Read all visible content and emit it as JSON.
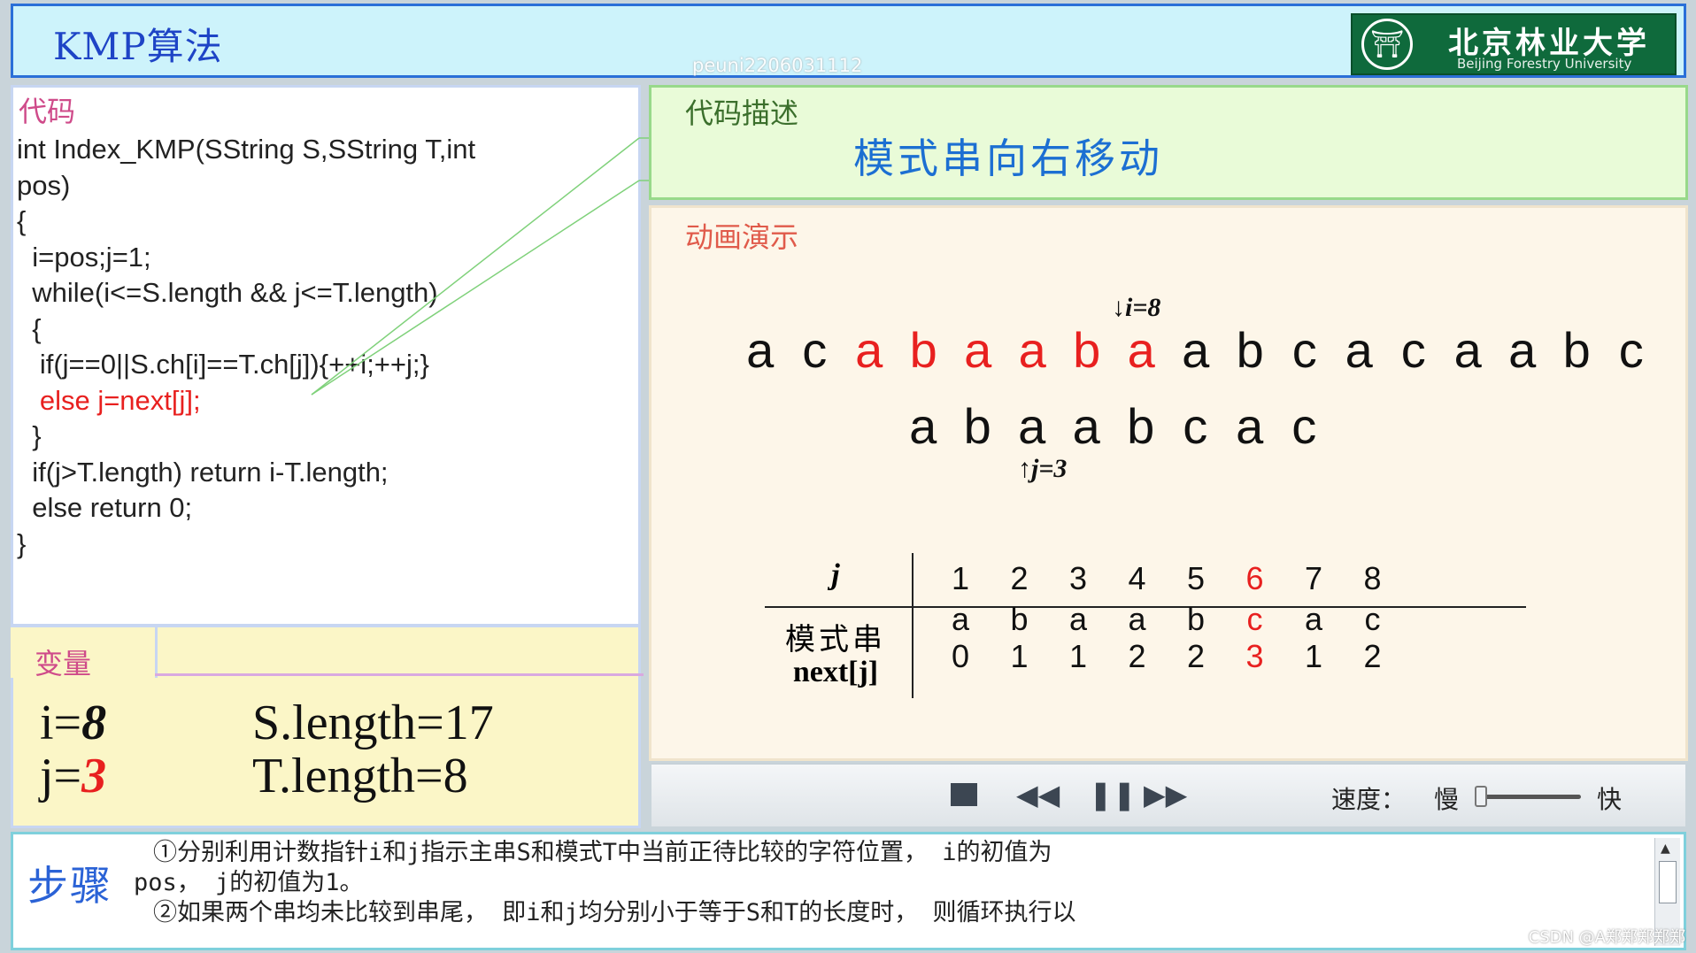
{
  "header": {
    "title": "KMP算法",
    "logo_cn": "北京林业大学",
    "logo_en": "Beijing Forestry University",
    "watermark": "peuni2206031112"
  },
  "code_panel": {
    "label": "代码",
    "lines": [
      "int Index_KMP(SString S,SString T,int",
      "pos)",
      "{",
      "  i=pos;j=1;",
      "  while(i<=S.length && j<=T.length)",
      "  {",
      "   if(j==0||S.ch[i]==T.ch[j]){++i;++j;}",
      "   else j=next[j];",
      "  }",
      "  if(j>T.length) return i-T.length;",
      "  else return 0;",
      "}"
    ],
    "highlight_line": 7,
    "highlight_color": "#e8201f"
  },
  "variables": {
    "label": "变量",
    "i_label": "i=",
    "i_value": "8",
    "j_label": "j=",
    "j_value": "3",
    "s_length": "S.length=17",
    "t_length": "T.length=8"
  },
  "description": {
    "label": "代码描述",
    "text": "模式串向右移动"
  },
  "animation": {
    "label": "动画演示",
    "main_string": [
      "a",
      "c",
      "a",
      "b",
      "a",
      "a",
      "b",
      "a",
      "a",
      "b",
      "c",
      "a",
      "c",
      "a",
      "a",
      "b",
      "c"
    ],
    "main_highlight": [
      2,
      3,
      4,
      5,
      6,
      7
    ],
    "pattern_string": [
      "a",
      "b",
      "a",
      "a",
      "b",
      "c",
      "a",
      "c"
    ],
    "pointer_i": "i=8",
    "pointer_j": "j=3",
    "next_table": {
      "header_j": "j",
      "header_pattern": "模式串",
      "header_next": "next[j]",
      "j": [
        "1",
        "2",
        "3",
        "4",
        "5",
        "6",
        "7",
        "8"
      ],
      "pattern": [
        "a",
        "b",
        "a",
        "a",
        "b",
        "c",
        "a",
        "c"
      ],
      "next": [
        "0",
        "1",
        "1",
        "2",
        "2",
        "3",
        "1",
        "2"
      ],
      "highlight_col": 5
    }
  },
  "controls": {
    "stop_icon": "stop-icon",
    "rewind_icon": "rewind-icon",
    "pause_icon": "pause-icon",
    "forward_icon": "fast-forward-icon",
    "speed_label": "速度：",
    "slow": "慢",
    "fast": "快",
    "speed_level": 0.05
  },
  "steps": {
    "label": "步骤",
    "line1": "①分别利用计数指针i和j指示主串S和模式T中当前正待比较的字符位置， i的初值为",
    "line2": "pos， j的初值为1。",
    "line3": "②如果两个串均未比较到串尾， 即i和j均分别小于等于S和T的长度时， 则循环执行以"
  },
  "footer": {
    "csdn": "CSDN @A郑郑郑郑郑"
  },
  "colors": {
    "accent_red": "#e8201f",
    "title_blue": "#1e44c6",
    "desc_blue": "#1c6fd2"
  }
}
